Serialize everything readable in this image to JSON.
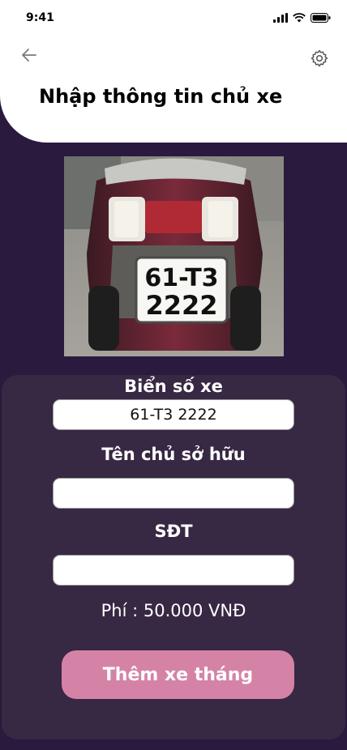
{
  "status_bar": {
    "time": "9:41"
  },
  "header": {
    "title": "Nhập thông tin chủ xe",
    "back_icon": "arrow-left-icon",
    "settings_icon": "gear-icon"
  },
  "photo": {
    "plate_line1": "61-T3",
    "plate_line2": "2222"
  },
  "form": {
    "plate_label": "Biển số xe",
    "plate_value": "61-T3 2222",
    "owner_label": "Tên chủ sở hữu",
    "owner_value": "",
    "phone_label": "SĐT",
    "phone_value": "",
    "fee_text": "Phí : 50.000 VNĐ",
    "submit_label": "Thêm xe tháng"
  },
  "colors": {
    "background": "#2a1a3d",
    "card": "#372843",
    "button": "#d483a6"
  }
}
